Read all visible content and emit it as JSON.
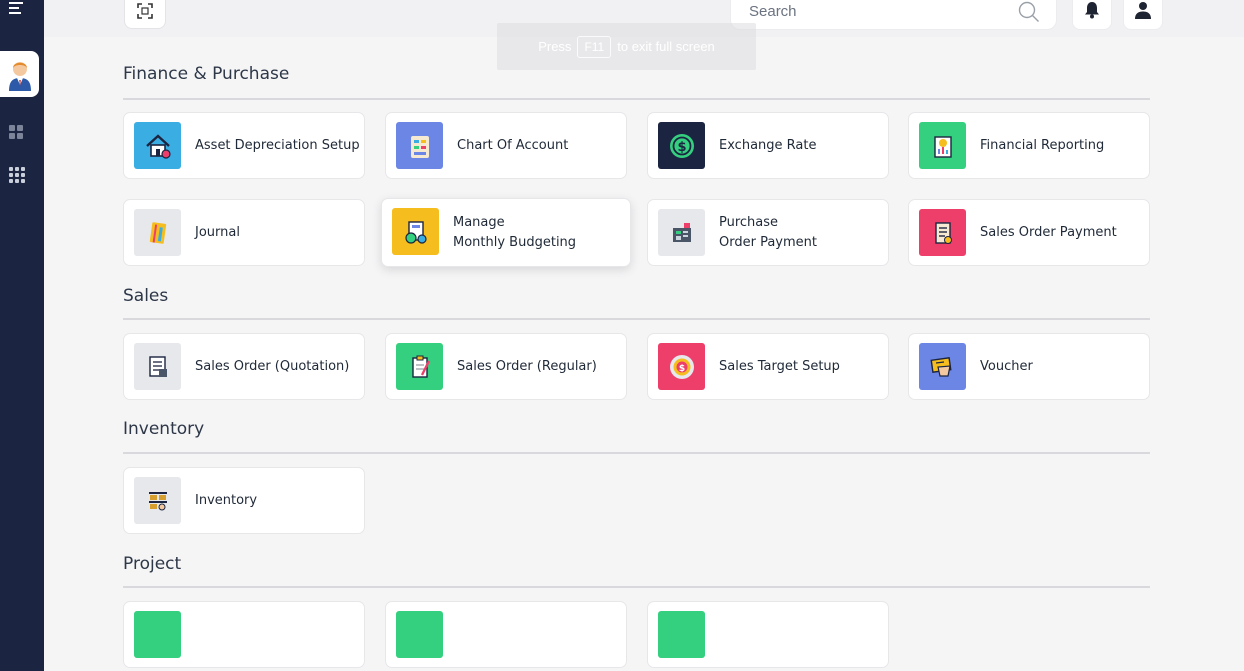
{
  "search": {
    "placeholder": "Search"
  },
  "fullscreen_toast": {
    "prefix": "Press",
    "key": "F11",
    "suffix": "to exit full screen"
  },
  "colors": {
    "sidebar": "#1b2440",
    "blue": "#3aaee3",
    "indigo": "#6b86e4",
    "navy": "#1b2440",
    "green": "#35d07f",
    "light": "#e6e8ec",
    "yellow": "#f6bd1e",
    "pink": "#ee3f6b"
  },
  "sections": [
    {
      "title": "Finance & Purchase",
      "cards": [
        {
          "label": "Asset Depreciation Setup",
          "icon": "house-icon",
          "color": "#3aaee3"
        },
        {
          "label": "Chart Of Account",
          "icon": "chart-icon",
          "color": "#6b86e4"
        },
        {
          "label": "Exchange Rate",
          "icon": "dollar-coin-icon",
          "color": "#1b2440"
        },
        {
          "label": "Financial Reporting",
          "icon": "report-icon",
          "color": "#35d07f"
        },
        {
          "label": "Journal",
          "icon": "notebook-icon",
          "color": "#e6e8ec"
        },
        {
          "label_1": "Manage",
          "label_2": "Monthly Budgeting",
          "icon": "budget-icon",
          "color": "#f6bd1e"
        },
        {
          "label_1": "Purchase",
          "label_2": "Order Payment",
          "icon": "cash-register-icon",
          "color": "#e6e8ec"
        },
        {
          "label": "Sales Order Payment",
          "icon": "receipt-icon",
          "color": "#ee3f6b"
        }
      ]
    },
    {
      "title": "Sales",
      "cards": [
        {
          "label": "Sales Order (Quotation)",
          "icon": "quotation-icon",
          "color": "#e6e8ec"
        },
        {
          "label": "Sales Order (Regular)",
          "icon": "clipboard-icon",
          "color": "#35d07f"
        },
        {
          "label": "Sales Target Setup",
          "icon": "target-icon",
          "color": "#ee3f6b"
        },
        {
          "label": "Voucher",
          "icon": "voucher-icon",
          "color": "#6b86e4"
        }
      ]
    },
    {
      "title": "Inventory",
      "cards": [
        {
          "label": "Inventory",
          "icon": "warehouse-icon",
          "color": "#e6e8ec"
        }
      ]
    },
    {
      "title": "Project",
      "cards": [
        {
          "label": "",
          "icon": "project-icon",
          "color": "#35d07f"
        },
        {
          "label": "",
          "icon": "project-icon",
          "color": "#35d07f"
        },
        {
          "label": "",
          "icon": "project-icon",
          "color": "#35d07f"
        }
      ]
    }
  ]
}
